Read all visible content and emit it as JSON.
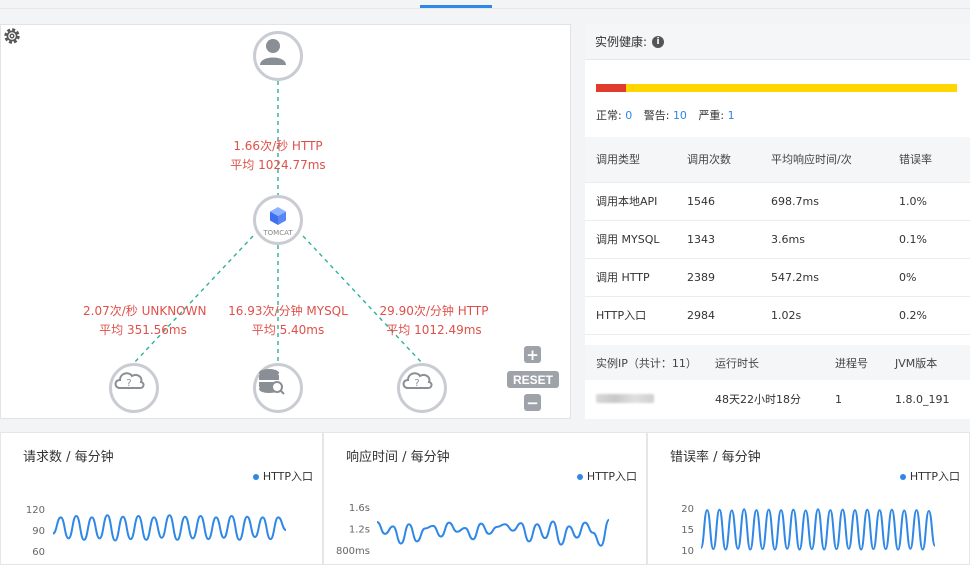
{
  "topology": {
    "edges": [
      {
        "rate": "1.66次/秒 HTTP",
        "avg": "平均 1024.77ms"
      },
      {
        "rate": "2.07次/秒 UNKNOWN",
        "avg": "平均 351.56ms"
      },
      {
        "rate": "16.93次/分钟 MYSQL",
        "avg": "平均 5.40ms"
      },
      {
        "rate": "29.90次/分钟 HTTP",
        "avg": "平均 1012.49ms"
      }
    ],
    "tomcat_label": "TOMCAT",
    "reset_label": "RESET",
    "zoom_in_label": "+",
    "zoom_out_label": "−",
    "edge_color": "#2cb29a",
    "label_color": "#e0504a"
  },
  "health": {
    "title": "实例健康:",
    "info_icon": "info-icon",
    "normal_label": "正常:",
    "normal_count": "0",
    "warn_label": "警告:",
    "warn_count": "10",
    "severe_label": "严重:",
    "severe_count": "1",
    "bar": {
      "red": 1,
      "yellow": 10,
      "total": 11,
      "red_color": "#e03b2d",
      "yellow_color": "#ffd600"
    }
  },
  "stats": {
    "headers": [
      "调用类型",
      "调用次数",
      "平均响应时间/次",
      "错误率"
    ],
    "rows": [
      [
        "调用本地API",
        "1546",
        "698.7ms",
        "1.0%"
      ],
      [
        "调用 MYSQL",
        "1343",
        "3.6ms",
        "0.1%"
      ],
      [
        "调用 HTTP",
        "2389",
        "547.2ms",
        "0%"
      ],
      [
        "HTTP入口",
        "2984",
        "1.02s",
        "0.2%"
      ]
    ]
  },
  "instances": {
    "headers": [
      "实例IP（共计：11）",
      "运行时长",
      "进程号",
      "JVM版本"
    ],
    "rows": [
      {
        "uptime": "48天22小时18分",
        "pid": "1",
        "jvm": "1.8.0_191"
      }
    ]
  },
  "charts": [
    {
      "title": "请求数 / 每分钟",
      "legend": "HTTP入口",
      "yticks": [
        "120",
        "90",
        "60"
      ],
      "ylim": [
        60,
        120
      ]
    },
    {
      "title": "响应时间 / 每分钟",
      "legend": "HTTP入口",
      "yticks": [
        "1.6s",
        "1.2s",
        "800ms"
      ],
      "ylim": [
        800,
        1600
      ]
    },
    {
      "title": "错误率 / 每分钟",
      "legend": "HTTP入口",
      "yticks": [
        "20",
        "15",
        "10"
      ],
      "ylim": [
        10,
        20
      ]
    }
  ],
  "chart_data": [
    {
      "type": "line",
      "title": "请求数 / 每分钟",
      "series": [
        {
          "name": "HTTP入口",
          "values": [
            85,
            108,
            78,
            110,
            76,
            108,
            78,
            111,
            75,
            109,
            77,
            110,
            76,
            108,
            79,
            111,
            76,
            109,
            78,
            110,
            77,
            108,
            79,
            110,
            76,
            109,
            80,
            108,
            77,
            108,
            90
          ]
        }
      ],
      "ylim": [
        60,
        120
      ]
    },
    {
      "type": "line",
      "title": "响应时间 / 每分钟",
      "series": [
        {
          "name": "HTTP入口",
          "values": [
            1320,
            1100,
            1240,
            920,
            1280,
            960,
            1200,
            1250,
            1050,
            1310,
            1140,
            1210,
            1000,
            1290,
            1100,
            1230,
            1280,
            1160,
            1300,
            960,
            1280,
            1020,
            1330,
            900,
            1240,
            1030,
            1310,
            1120,
            880,
            1360
          ]
        }
      ],
      "ylim": [
        800,
        1600
      ]
    },
    {
      "type": "line",
      "title": "错误率 / 每分钟",
      "series": [
        {
          "name": "HTTP入口",
          "values": [
            10.5,
            19.5,
            10.2,
            19.6,
            10.1,
            19.4,
            10.3,
            19.7,
            10.1,
            19.5,
            10.2,
            19.6,
            10.1,
            19.5,
            10.3,
            19.6,
            10.1,
            19.4,
            10.2,
            19.7,
            10.1,
            19.5,
            10.2,
            19.6,
            10.3,
            19.5,
            10.1,
            19.6,
            10.2,
            19.5,
            10.2,
            19.6,
            10.1,
            19.4,
            10.3,
            19.5,
            10.1,
            19.3,
            11
          ]
        }
      ],
      "ylim": [
        10,
        20
      ]
    }
  ]
}
